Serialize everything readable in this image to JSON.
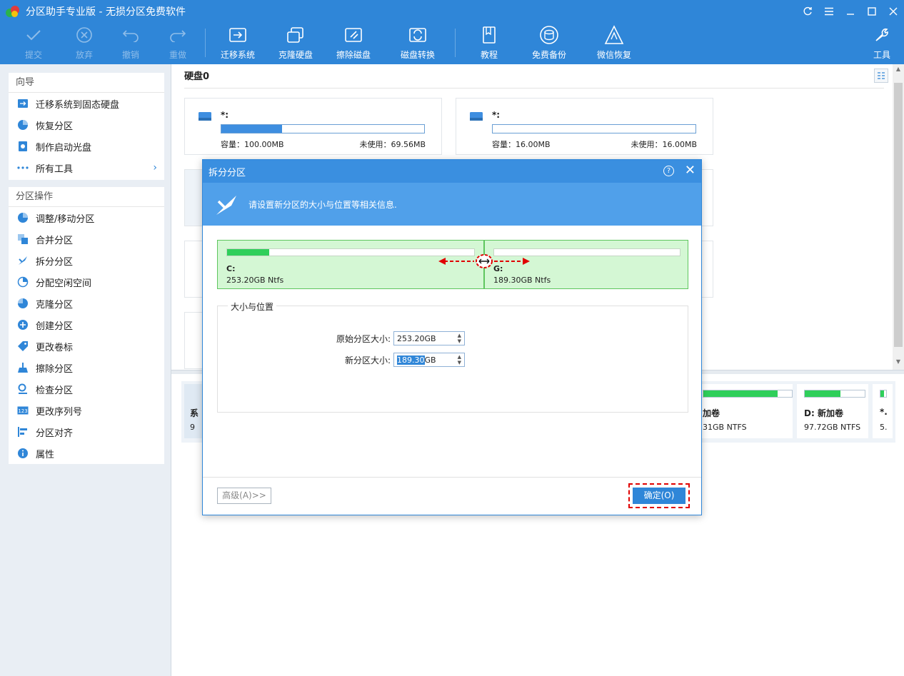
{
  "window": {
    "title": "分区助手专业版 - 无损分区免费软件"
  },
  "toolbar": {
    "commit": "提交",
    "discard": "放弃",
    "undo": "撤销",
    "redo": "重做",
    "migrate_os": "迁移系统",
    "clone_disk": "克隆硬盘",
    "wipe_disk": "擦除磁盘",
    "disk_convert": "磁盘转换",
    "tutorial": "教程",
    "free_backup": "免费备份",
    "wechat_restore": "微信恢复",
    "tools": "工具"
  },
  "wizard": {
    "header": "向导",
    "items": [
      "迁移系统到固态硬盘",
      "恢复分区",
      "制作启动光盘",
      "所有工具"
    ]
  },
  "operations": {
    "header": "分区操作",
    "items": [
      "调整/移动分区",
      "合并分区",
      "拆分分区",
      "分配空闲空间",
      "克隆分区",
      "创建分区",
      "更改卷标",
      "擦除分区",
      "检查分区",
      "更改序列号",
      "分区对齐",
      "属性"
    ]
  },
  "disk": {
    "title": "硬盘0",
    "cards": [
      {
        "name": "*:",
        "capacity": "容量：100.00MB",
        "unused": "未使用：69.56MB",
        "used_fraction": 0.3
      },
      {
        "name": "*:",
        "capacity": "容量：16.00MB",
        "unused": "未使用：16.00MB",
        "used_fraction": 0.0
      }
    ]
  },
  "lower_volumes": [
    {
      "name": "加卷",
      "size": "31GB NTFS",
      "used_fraction": 0.84
    },
    {
      "name": "D: 新加卷",
      "size": "97.72GB NTFS",
      "used_fraction": 0.6
    },
    {
      "name": "*.",
      "size": "5.",
      "used_fraction": 0.6
    }
  ],
  "lower_stub": {
    "name": "系",
    "size": "9"
  },
  "dialog": {
    "title": "拆分分区",
    "banner": "请设置新分区的大小与位置等相关信息.",
    "left_part": {
      "name": "C:",
      "size": "253.20GB Ntfs",
      "used_fraction": 0.17
    },
    "right_part": {
      "name": "G:",
      "size": "189.30GB Ntfs",
      "used_fraction": 0.0
    },
    "group_label": "大小与位置",
    "orig_label": "原始分区大小:",
    "orig_value": "253.20GB",
    "new_label": "新分区大小:",
    "new_value_selected": "189.30",
    "new_value_unit": "GB",
    "advanced": "高级(A)>>",
    "ok": "确定(O)"
  },
  "colors": {
    "accent": "#2f86d8",
    "partition_green": "#2fcf5a",
    "highlight_red": "#e00000"
  }
}
